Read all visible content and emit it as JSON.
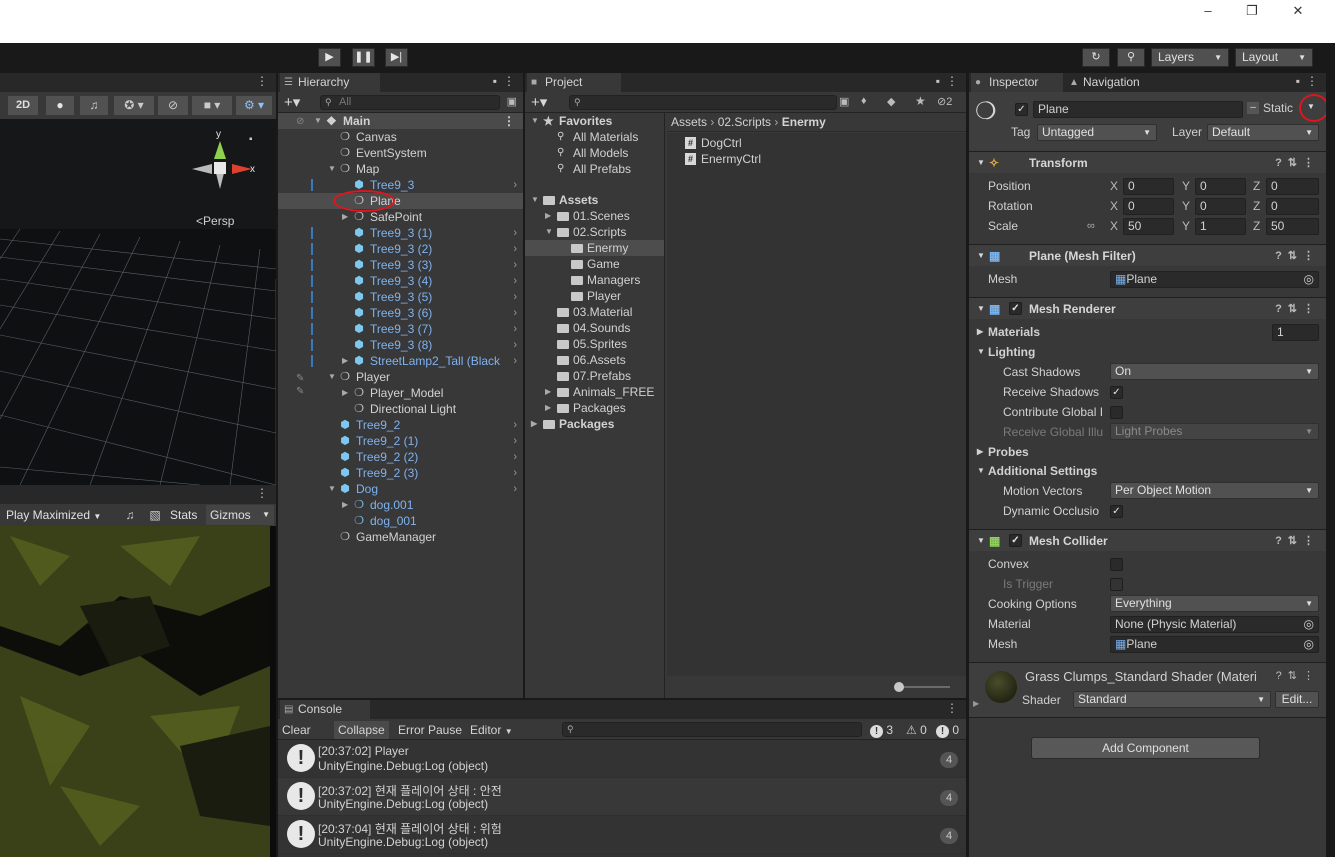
{
  "toolbar": {
    "play_icon": "play-icon",
    "pause_icon": "pause-icon",
    "step_icon": "step-icon",
    "layers": "Layers",
    "layout": "Layout"
  },
  "scene": {
    "btn_2d": "2D",
    "persp": "Persp",
    "axis_y": "y",
    "axis_x": "x"
  },
  "game": {
    "play_maximized": "Play Maximized",
    "stats": "Stats",
    "gizmos": "Gizmos"
  },
  "hierarchy": {
    "tab": "Hierarchy",
    "search_placeholder": "All",
    "scene": "Main",
    "items": [
      "Canvas",
      "EventSystem",
      "Map",
      "Tree9_3",
      "Plane",
      "SafePoint",
      "Tree9_3 (1)",
      "Tree9_3 (2)",
      "Tree9_3 (3)",
      "Tree9_3 (4)",
      "Tree9_3 (5)",
      "Tree9_3 (6)",
      "Tree9_3 (7)",
      "Tree9_3 (8)",
      "StreetLamp2_Tall (Black",
      "Player",
      "Player_Model",
      "Directional Light",
      "Tree9_2",
      "Tree9_2 (1)",
      "Tree9_2 (2)",
      "Tree9_2 (3)",
      "Dog",
      "dog.001",
      "dog_001",
      "GameManager"
    ]
  },
  "project": {
    "tab": "Project",
    "favorites": "Favorites",
    "fav_items": [
      "All Materials",
      "All Models",
      "All Prefabs"
    ],
    "assets": "Assets",
    "folders": [
      "01.Scenes",
      "02.Scripts",
      "Enermy",
      "Game",
      "Managers",
      "Player",
      "03.Material",
      "04.Sounds",
      "05.Sprites",
      "06.Assets",
      "07.Prefabs",
      "Animals_FREE",
      "Packages"
    ],
    "packages": "Packages",
    "breadcrumb": [
      "Assets",
      "02.Scripts",
      "Enermy"
    ],
    "files": [
      "DogCtrl",
      "EnermyCtrl"
    ],
    "hidden_count": "2"
  },
  "inspector": {
    "tab": "Inspector",
    "tab2": "Navigation",
    "object_name": "Plane",
    "static_label": "Static",
    "tag_label": "Tag",
    "tag_value": "Untagged",
    "layer_label": "Layer",
    "layer_value": "Default",
    "transform": {
      "title": "Transform",
      "position_label": "Position",
      "rotation_label": "Rotation",
      "scale_label": "Scale",
      "position": [
        "0",
        "0",
        "0"
      ],
      "rotation": [
        "0",
        "0",
        "0"
      ],
      "scale": [
        "50",
        "1",
        "50"
      ],
      "axes": [
        "X",
        "Y",
        "Z"
      ]
    },
    "mesh_filter": {
      "title": "Plane (Mesh Filter)",
      "mesh_label": "Mesh",
      "mesh_value": "Plane"
    },
    "mesh_renderer": {
      "title": "Mesh Renderer",
      "materials_label": "Materials",
      "materials_count": "1",
      "lighting_label": "Lighting",
      "cast_shadows_label": "Cast Shadows",
      "cast_shadows_value": "On",
      "receive_shadows_label": "Receive Shadows",
      "contribute_gi_label": "Contribute Global I",
      "receive_gi_label": "Receive Global Illu",
      "receive_gi_value": "Light Probes",
      "probes_label": "Probes",
      "additional_label": "Additional Settings",
      "motion_vectors_label": "Motion Vectors",
      "motion_vectors_value": "Per Object Motion",
      "dynamic_occlusion_label": "Dynamic Occlusio"
    },
    "mesh_collider": {
      "title": "Mesh Collider",
      "convex_label": "Convex",
      "is_trigger_label": "Is Trigger",
      "cooking_label": "Cooking Options",
      "cooking_value": "Everything",
      "material_label": "Material",
      "material_value": "None (Physic Material)",
      "mesh_label": "Mesh",
      "mesh_value": "Plane"
    },
    "material": {
      "title": "Grass Clumps_Standard Shader (Materi",
      "shader_label": "Shader",
      "shader_value": "Standard",
      "edit": "Edit..."
    },
    "add_component": "Add Component"
  },
  "console": {
    "tab": "Console",
    "clear": "Clear",
    "collapse": "Collapse",
    "error_pause": "Error Pause",
    "editor": "Editor",
    "count_log": "3",
    "count_warn": "0",
    "count_err": "0",
    "rows": [
      {
        "l1": "[20:37:02] Player",
        "l2": "UnityEngine.Debug:Log (object)",
        "count": "4"
      },
      {
        "l1": "[20:37:02] 현재 플레이어 상태 : 안전",
        "l2": "UnityEngine.Debug:Log (object)",
        "count": "4"
      },
      {
        "l1": "[20:37:04] 현재 플레이어 상태 : 위험",
        "l2": "UnityEngine.Debug:Log (object)",
        "count": "4"
      }
    ]
  }
}
